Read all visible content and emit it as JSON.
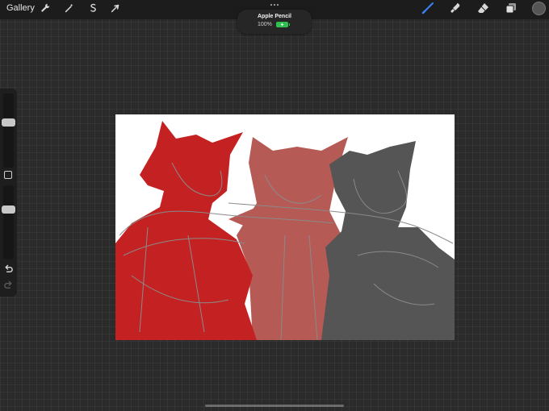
{
  "toolbar": {
    "gallery_label": "Gallery",
    "left_tools": [
      {
        "icon": "wrench-icon",
        "name": "actions"
      },
      {
        "icon": "magic-wand-icon",
        "name": "adjustments"
      },
      {
        "icon": "selection-s-icon",
        "name": "selection"
      },
      {
        "icon": "arrow-cursor-icon",
        "name": "transform"
      }
    ],
    "right_tools": [
      {
        "icon": "brush-icon",
        "name": "brush",
        "active": true
      },
      {
        "icon": "smudge-icon",
        "name": "smudge"
      },
      {
        "icon": "eraser-icon",
        "name": "eraser"
      },
      {
        "icon": "layers-icon",
        "name": "layers"
      }
    ],
    "active_color": "#555555",
    "active_tool_color": "#3b82f6"
  },
  "pencil_notice": {
    "title": "Apple Pencil",
    "battery": "100%"
  },
  "sidebar": {
    "brush_size": 0.62,
    "opacity": 0.7
  },
  "canvas": {
    "colors": {
      "left_figure": "#c42222",
      "middle_figure": "#b65a55",
      "right_figure": "#555555",
      "sketch_line": "#8a8a8a"
    }
  }
}
